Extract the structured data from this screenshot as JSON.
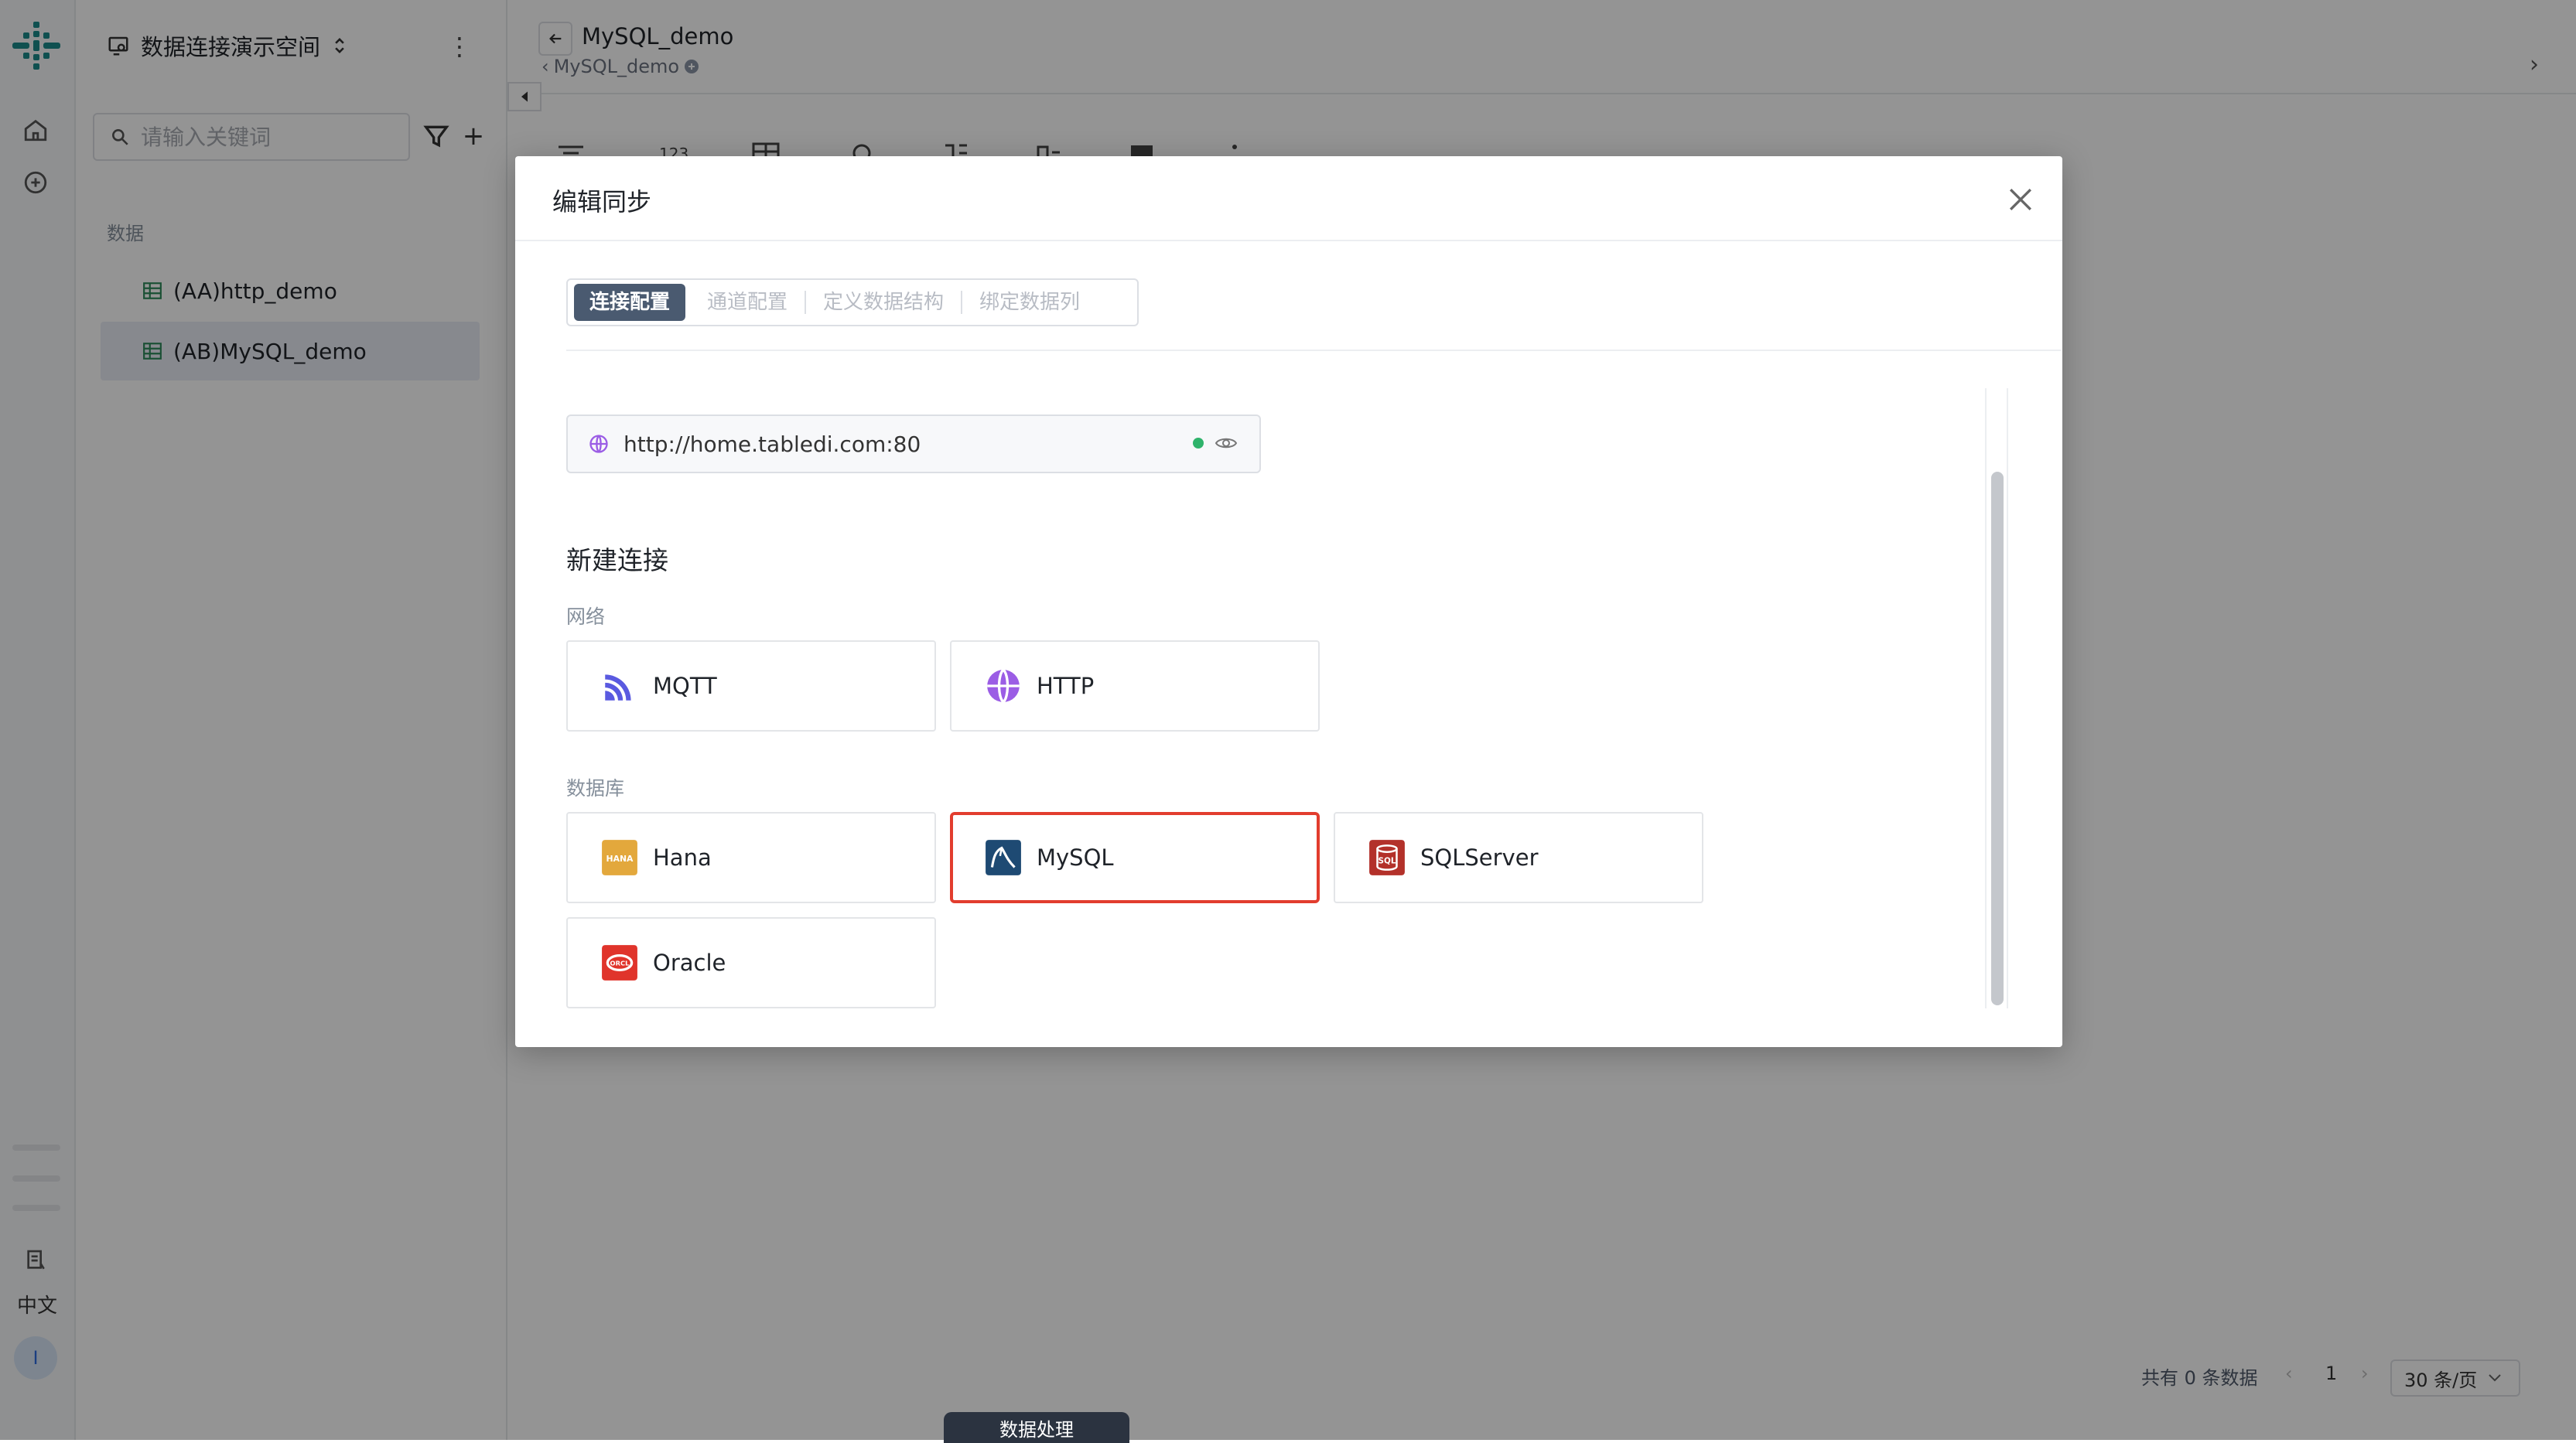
{
  "app": {
    "workspace": "数据连接演示空间",
    "language": "中文",
    "avatar_initial": "I"
  },
  "sidebar": {
    "search_placeholder": "请输入关键词",
    "section_label": "数据",
    "items": [
      {
        "label": "(AA)http_demo",
        "active": false
      },
      {
        "label": "(AB)MySQL_demo",
        "active": true
      }
    ]
  },
  "main": {
    "title": "MySQL_demo",
    "breadcrumb": "MySQL_demo",
    "footer": {
      "total": "共有 0 条数据",
      "page": "1",
      "page_size": "30 条/页"
    },
    "bottom_tab": "数据处理"
  },
  "modal": {
    "title": "编辑同步",
    "steps": [
      "连接配置",
      "通道配置",
      "定义数据结构",
      "绑定数据列"
    ],
    "active_step": 0,
    "connection_url": "http://home.tabledi.com:80",
    "connection_status_color": "#2fb36b",
    "new_connection_heading": "新建连接",
    "groups": [
      {
        "label": "网络",
        "items": [
          {
            "label": "MQTT",
            "icon": "mqtt-icon"
          },
          {
            "label": "HTTP",
            "icon": "http-globe-icon"
          }
        ]
      },
      {
        "label": "数据库",
        "items": [
          {
            "label": "Hana",
            "icon": "hana-icon"
          },
          {
            "label": "MySQL",
            "icon": "mysql-icon",
            "selected": true
          },
          {
            "label": "SQLServer",
            "icon": "sqlserver-icon"
          },
          {
            "label": "Oracle",
            "icon": "oracle-icon"
          }
        ]
      }
    ]
  },
  "colors": {
    "accent": "#4a5a70",
    "selected_border": "#e23d2e",
    "brand": "#1a8a8a"
  }
}
